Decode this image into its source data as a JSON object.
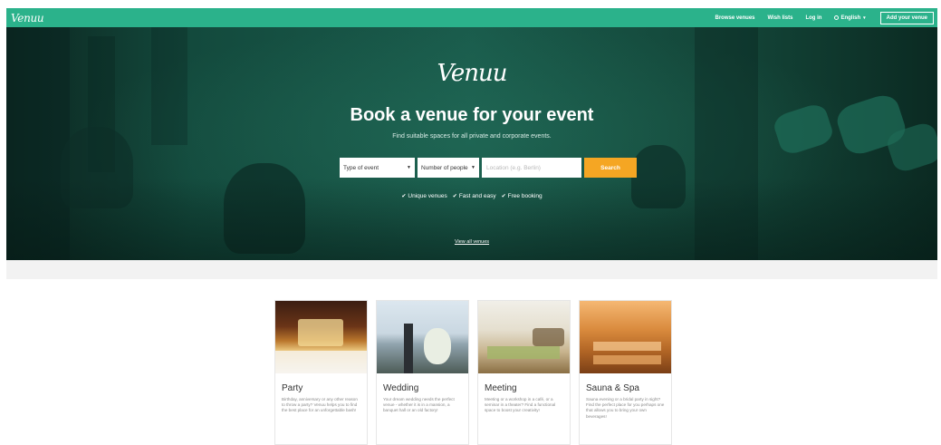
{
  "header": {
    "logo": "Venuu",
    "nav": {
      "browse": "Browse venues",
      "wish": "Wish lists",
      "login": "Log in",
      "language": "English",
      "add": "Add your venue"
    }
  },
  "hero": {
    "logo": "Venuu",
    "title": "Book a venue for your event",
    "subtitle": "Find suitable spaces for all private and corporate events.",
    "search": {
      "type_of_event": "Type of event",
      "number_of_people": "Number of people",
      "location_placeholder": "Location (e.g. Berlin)",
      "button": "Search"
    },
    "features": [
      "Unique venues",
      "Fast and easy",
      "Free booking"
    ],
    "view_all": "View all venues"
  },
  "cards": [
    {
      "title": "Party",
      "desc": "Birthday, anniversary or any other reason to throw a party? Venuu helps you to find the best place for an unforgettable bash!"
    },
    {
      "title": "Wedding",
      "desc": "Your dream wedding needs the perfect venue - whether it is in a mansion, a banquet hall or an old factory!"
    },
    {
      "title": "Meeting",
      "desc": "Meeting or a workshop in a café, or a seminar in a theater? Find a functional space to boost your creativity!"
    },
    {
      "title": "Sauna & Spa",
      "desc": "Sauna evening or a bridal party in sight? Find the perfect place for you perhaps one that allows you to bring your own beverages!"
    }
  ],
  "colors": {
    "brand": "#2bb28b",
    "search_button": "#f5a623"
  }
}
